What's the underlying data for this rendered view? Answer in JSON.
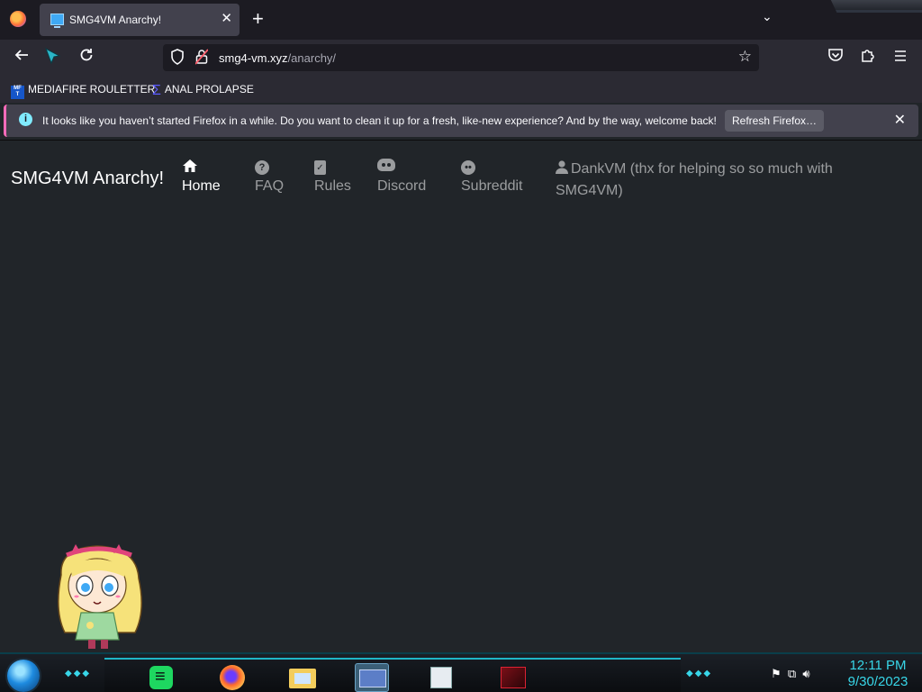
{
  "browser": {
    "tab_title": "SMG4VM Anarchy!",
    "tab_close_glyph": "✕",
    "new_tab_glyph": "+",
    "list_tabs_glyph": "⌄",
    "url_host": "smg4-vm.xyz",
    "url_path": "/anarchy/",
    "bookmarks": [
      {
        "label": "MEDIAFIRE ROULETTER",
        "icon": "mediafire-icon"
      },
      {
        "label": "ANAL PROLAPSE",
        "icon": "sigma-icon"
      }
    ],
    "notification": {
      "message": "It looks like you haven’t started Firefox in a while. Do you want to clean it up for a fresh, like-new experience? And by the way, welcome back!",
      "button_label": "Refresh Firefox…",
      "close_glyph": "✕"
    }
  },
  "site": {
    "brand": "SMG4VM Anarchy!",
    "nav": [
      {
        "label": "Home",
        "icon": "house-icon",
        "active": true
      },
      {
        "label": "FAQ",
        "icon": "question-icon"
      },
      {
        "label": "Rules",
        "icon": "clipboard-check-icon"
      },
      {
        "label": "Discord",
        "icon": "discord-icon"
      },
      {
        "label": "Subreddit",
        "icon": "reddit-icon"
      }
    ],
    "user_line": "DankVM (thx for helping so so much with SMG4VM)"
  },
  "taskbar": {
    "time": "12:11 PM",
    "date": "9/30/2023",
    "apps": [
      "spotify",
      "firefox",
      "file-explorer",
      "card-app",
      "document-app",
      "game-app"
    ]
  },
  "colors": {
    "page_bg": "#212529",
    "nav_muted": "rgba(255,255,255,0.55)",
    "accent_cyan": "#38d6e8",
    "notice_border": "#ff6bba"
  }
}
